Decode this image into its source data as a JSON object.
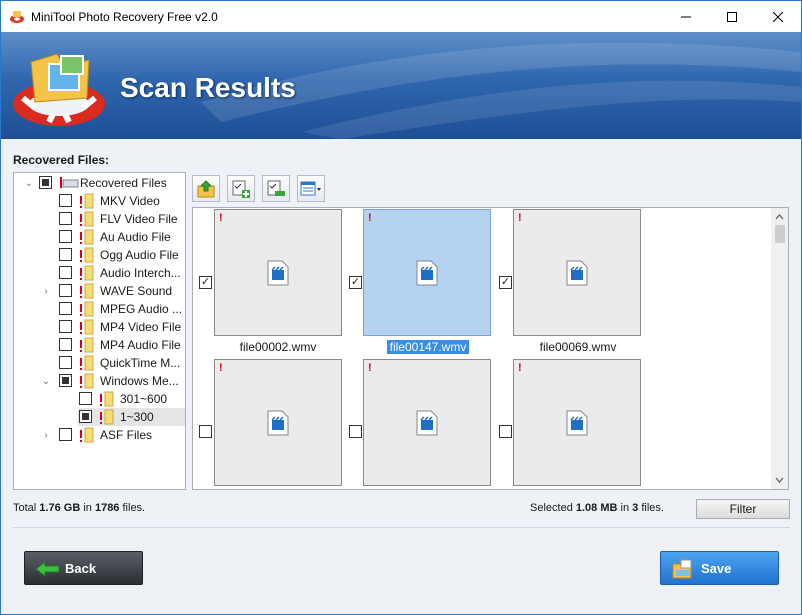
{
  "window": {
    "title": "MiniTool Photo Recovery Free v2.0"
  },
  "banner": {
    "title": "Scan Results"
  },
  "recovered_label": "Recovered Files:",
  "tree": {
    "root": {
      "label": "Recovered Files",
      "checked": "partial"
    },
    "items": [
      {
        "label": "MKV Video"
      },
      {
        "label": "FLV Video File"
      },
      {
        "label": "Au Audio File"
      },
      {
        "label": "Ogg Audio File"
      },
      {
        "label": "Audio Interch..."
      },
      {
        "label": "WAVE Sound"
      },
      {
        "label": "MPEG Audio ..."
      },
      {
        "label": "MP4 Video File"
      },
      {
        "label": "MP4 Audio File"
      },
      {
        "label": "QuickTime M..."
      },
      {
        "label": "Windows Me..."
      },
      {
        "label": "301~600"
      },
      {
        "label": "1~300"
      },
      {
        "label": "ASF Files"
      }
    ]
  },
  "thumbnails": [
    {
      "name": "file00002.wmv",
      "checked": true
    },
    {
      "name": "file00147.wmv",
      "checked": true
    },
    {
      "name": "file00069.wmv",
      "checked": true
    },
    {
      "name": "",
      "checked": false
    },
    {
      "name": "",
      "checked": false
    },
    {
      "name": "",
      "checked": false
    }
  ],
  "status": {
    "total_prefix": "Total ",
    "total_size": "1.76 GB",
    "total_mid": " in ",
    "total_count": "1786",
    "total_suffix": " files.",
    "selected_prefix": "Selected ",
    "selected_size": "1.08 MB",
    "selected_mid": " in ",
    "selected_count": "3",
    "selected_suffix": " files."
  },
  "buttons": {
    "filter": "Filter",
    "back": "Back",
    "save": "Save"
  },
  "colors": {
    "accent": "#2b78c9",
    "warning": "#d6001c",
    "selection": "#3a8ee6"
  }
}
